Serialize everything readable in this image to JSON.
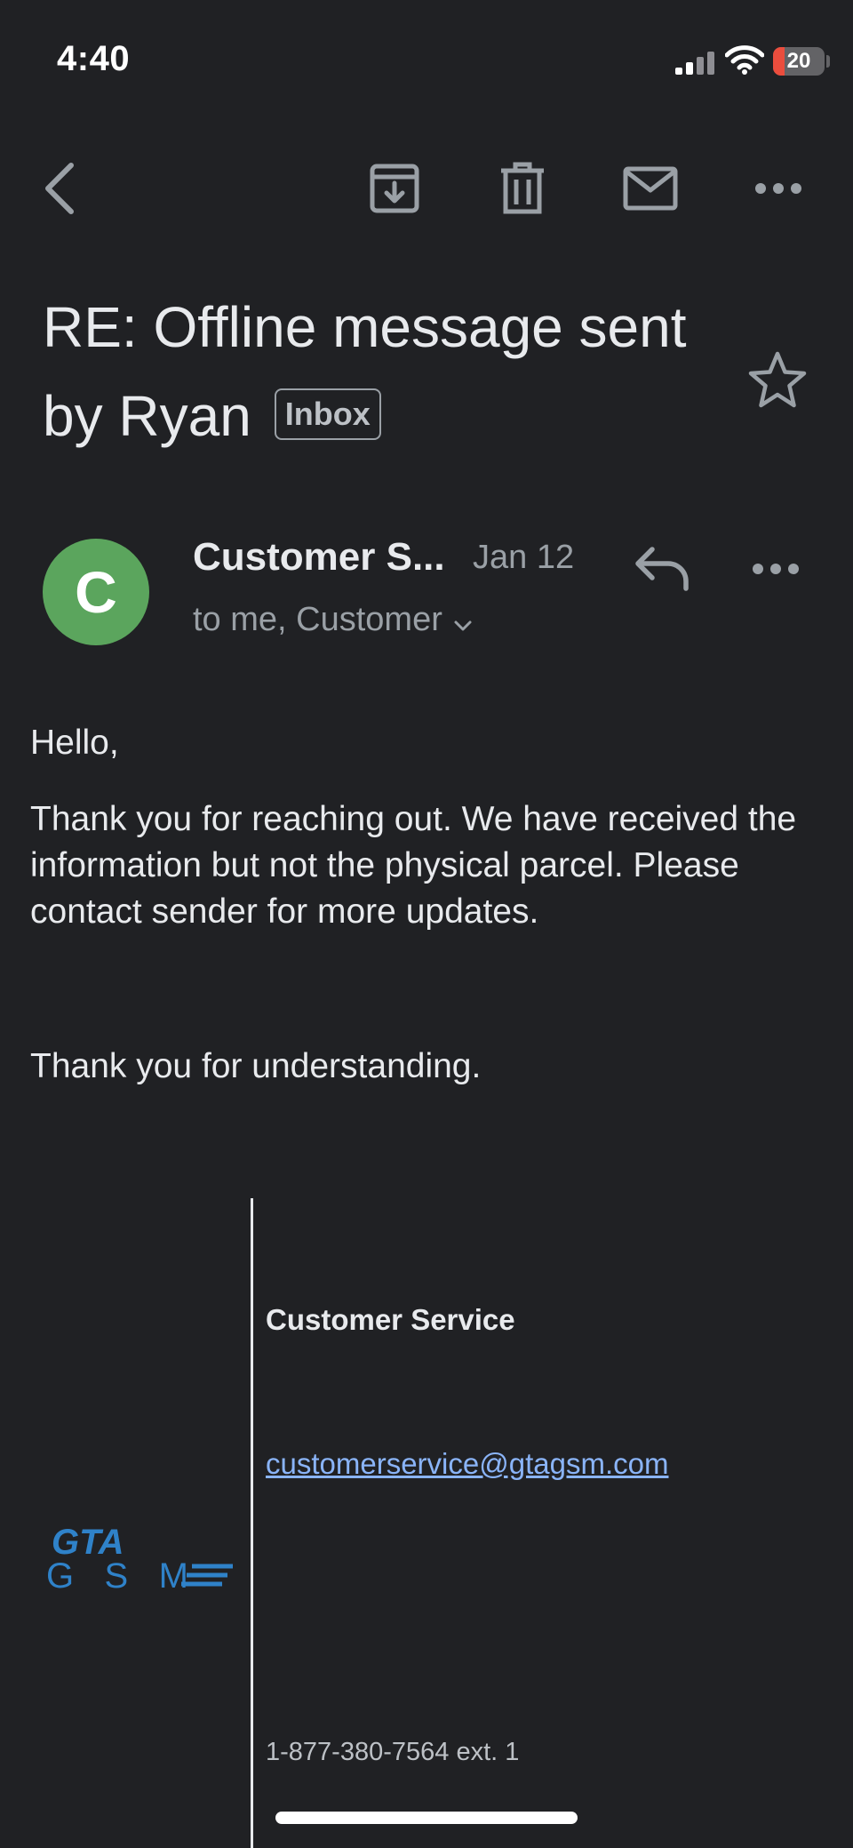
{
  "status_bar": {
    "time": "4:40",
    "battery_level": "20",
    "battery_color": "#eb4d3d",
    "icons": [
      "cellular-signal-icon",
      "wifi-icon",
      "battery-icon"
    ]
  },
  "toolbar": {
    "icons": [
      "back-arrow-icon",
      "archive-icon",
      "trash-icon",
      "mail-icon",
      "more-options-icon"
    ]
  },
  "email": {
    "subject": "RE: Offline message sent by Ryan",
    "label": "Inbox",
    "sender": {
      "initial": "C",
      "name": "Customer S...",
      "date": "Jan 12",
      "recipients": "to me, Customer",
      "avatar_color": "#5ba55d"
    },
    "body": {
      "greeting": "Hello,",
      "paragraph": "Thank you for reaching out. We have received the information but not the physical parcel. Please contact sender for more updates.",
      "closing": "Thank you for understanding."
    },
    "signature": {
      "logo_text_top": "GTA",
      "logo_text_bottom": "GSM",
      "name": "Customer Service",
      "email": "customerservice@gtagsm.com",
      "phone": "1-877-380-7564 ext. 1",
      "logo_color": "#2f82c9",
      "link_color": "#8ab4f8"
    }
  },
  "theme": {
    "background": "#202124",
    "text": "#e8eaed",
    "muted": "#9aa0a6"
  }
}
